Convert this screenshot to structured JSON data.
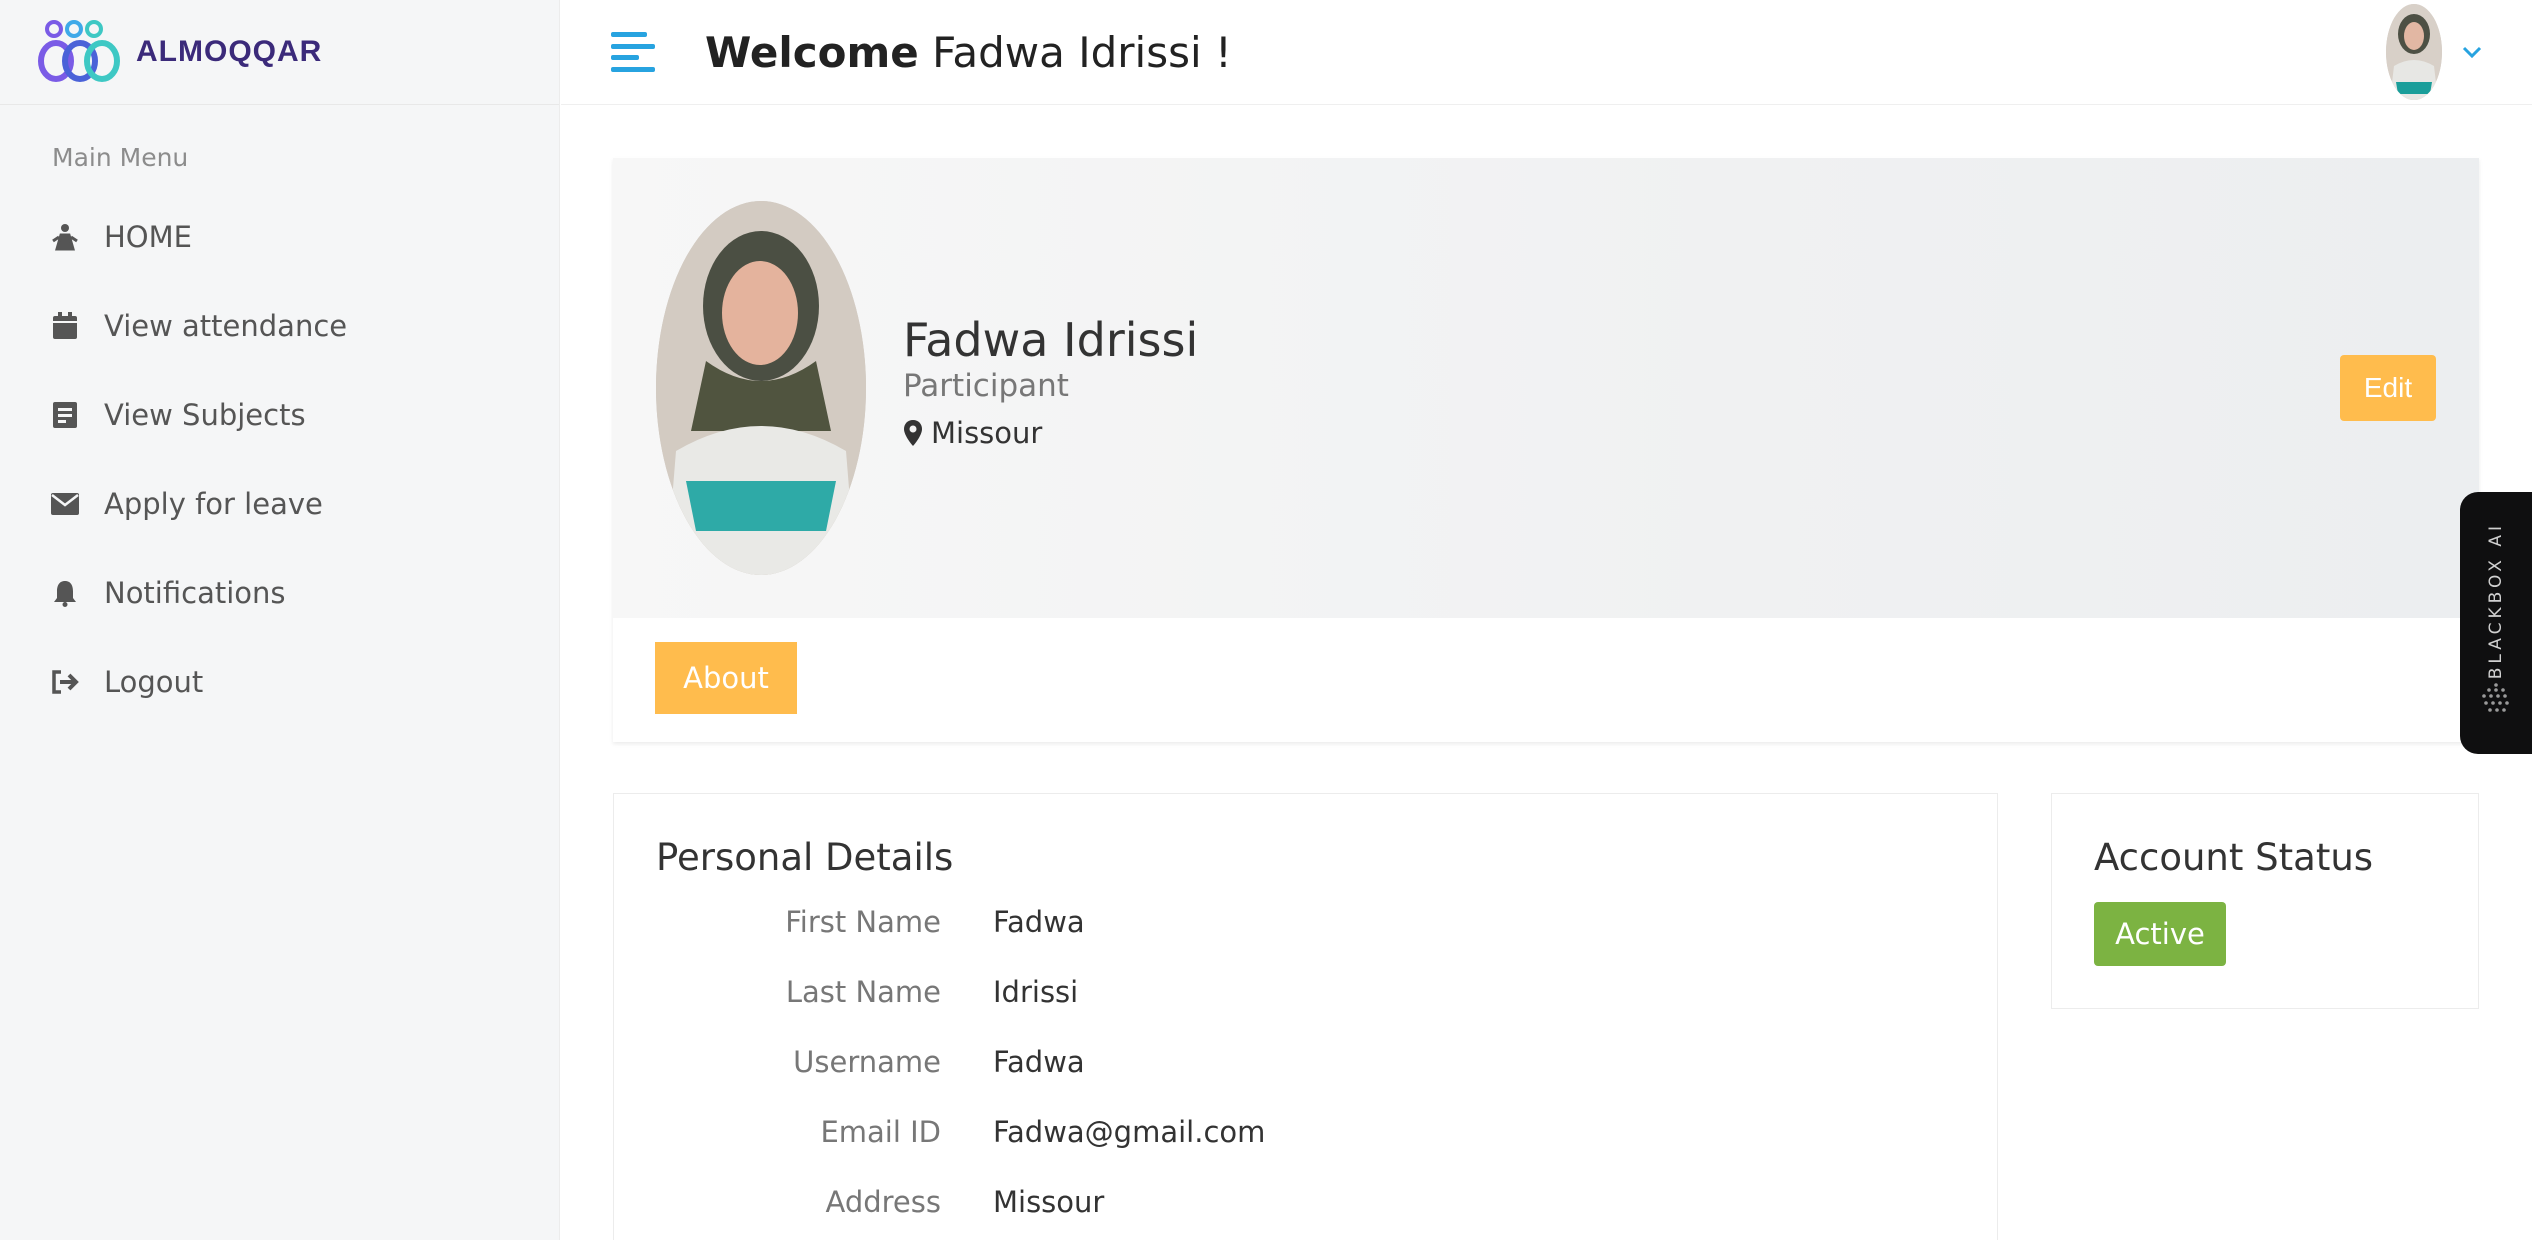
{
  "brand": {
    "name": "ALMOQQAR"
  },
  "sidebar": {
    "menu_title": "Main Menu",
    "items": [
      {
        "label": "HOME",
        "icon": "home-icon"
      },
      {
        "label": "View attendance",
        "icon": "calendar-icon"
      },
      {
        "label": "View Subjects",
        "icon": "document-icon"
      },
      {
        "label": "Apply for leave",
        "icon": "envelope-icon"
      },
      {
        "label": "Notifications",
        "icon": "bell-icon"
      },
      {
        "label": "Logout",
        "icon": "logout-icon"
      }
    ]
  },
  "header": {
    "welcome_bold": "Welcome",
    "welcome_name": "Fadwa Idrissi !"
  },
  "profile": {
    "name": "Fadwa Idrissi",
    "role": "Participant",
    "location": "Missour",
    "edit_label": "Edit",
    "about_label": "About"
  },
  "personal_details": {
    "title": "Personal Details",
    "rows": [
      {
        "key": "First Name",
        "value": "Fadwa"
      },
      {
        "key": "Last Name",
        "value": "Idrissi"
      },
      {
        "key": "Username",
        "value": "Fadwa"
      },
      {
        "key": "Email ID",
        "value": "Fadwa@gmail.com"
      },
      {
        "key": "Address",
        "value": "Missour"
      }
    ]
  },
  "account_status": {
    "title": "Account Status",
    "status": "Active"
  },
  "extension": {
    "label": "BLACKBOX AI"
  },
  "colors": {
    "accent_orange": "#ffbc4d",
    "accent_blue": "#27a3e0",
    "status_green": "#7cb342",
    "brand_purple": "#3b2a7a"
  }
}
